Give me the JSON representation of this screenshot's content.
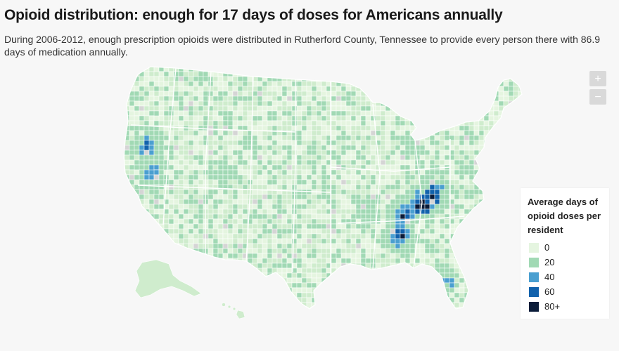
{
  "title": "Opioid distribution: enough for 17 days of doses for Americans annually",
  "subtitle": "During 2006-2012, enough prescription opioids were distributed in Rutherford County, Tennessee to provide every person there with 86.9 days of medication annually.",
  "controls": {
    "zoom_in": "+",
    "zoom_out": "−"
  },
  "legend": {
    "title": "Average days of opioid doses per resident",
    "items": [
      {
        "label": "0",
        "color": "#e5f5e0"
      },
      {
        "label": "20",
        "color": "#a1d9b4"
      },
      {
        "label": "40",
        "color": "#4a9fd0"
      },
      {
        "label": "60",
        "color": "#1262ac"
      },
      {
        "label": "80+",
        "color": "#0b1c39"
      }
    ]
  },
  "colors": {
    "land": "#cfeccd",
    "border": "#ffffff",
    "no_data": "#d5d5d5"
  }
}
